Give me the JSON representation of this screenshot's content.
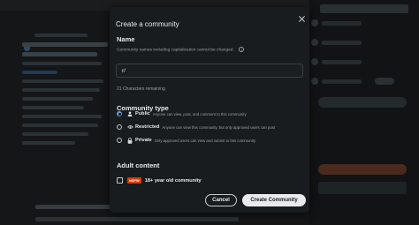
{
  "modal": {
    "title": "Create a community",
    "name_section": {
      "label": "Name",
      "hint": "Community names including capitalization cannot be changed.",
      "input_value": "r/",
      "counter": "21 Characters remaining"
    },
    "type_section": {
      "label": "Community type",
      "options": [
        {
          "name": "Public",
          "description": "Anyone can view, post, and comment to this community",
          "icon": "person-icon",
          "selected": true
        },
        {
          "name": "Restricted",
          "description": "Anyone can view this community, but only approved users can post",
          "icon": "eye-icon",
          "selected": false
        },
        {
          "name": "Private",
          "description": "Only approved users can view and submit to this community",
          "icon": "lock-icon",
          "selected": false
        }
      ]
    },
    "adult_section": {
      "label": "Adult content",
      "badge": "NSFW",
      "checkbox_label": "18+ year old community",
      "checked": false
    },
    "buttons": {
      "cancel": "Cancel",
      "create": "Create Community"
    }
  },
  "colors": {
    "modal_bg": "#181c1f",
    "accent_radio": "#6b9bd8",
    "nsfw_badge": "#d93a00",
    "primary_button": "#e8eaeb"
  }
}
